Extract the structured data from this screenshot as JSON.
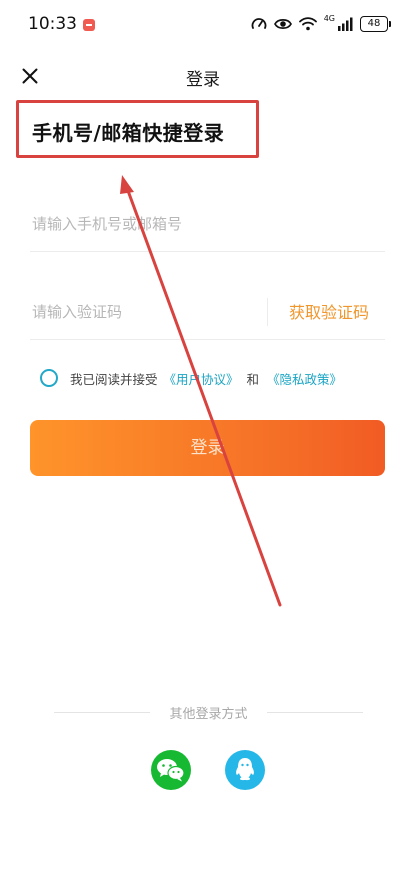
{
  "status_bar": {
    "time": "10:33",
    "network_label": "4G",
    "battery": "48",
    "icons": [
      "app-notification-icon",
      "speedometer-icon",
      "eye-icon",
      "wifi-icon",
      "cellular-signal-icon",
      "battery-icon"
    ]
  },
  "nav": {
    "title": "登录",
    "close_icon": "close-icon"
  },
  "heading": "手机号/邮箱快捷登录",
  "form": {
    "account_placeholder": "请输入手机号或邮箱号",
    "account_value": "",
    "code_placeholder": "请输入验证码",
    "code_value": "",
    "get_code_label": "获取验证码"
  },
  "agreement": {
    "prefix": "我已阅读并接受",
    "user_agreement": "《用户协议》",
    "and": "和",
    "privacy_policy": "《隐私政策》",
    "checked": false
  },
  "login_button": "登录",
  "other_login": {
    "label": "其他登录方式",
    "providers": [
      "wechat-icon",
      "qq-icon"
    ]
  },
  "colors": {
    "accent_orange": "#f56f27",
    "link_teal": "#1aa5c4",
    "get_code_orange": "#f0962b",
    "annotation_red": "#d9433f",
    "wechat_green": "#16b931",
    "qq_blue": "#24b7e8"
  }
}
